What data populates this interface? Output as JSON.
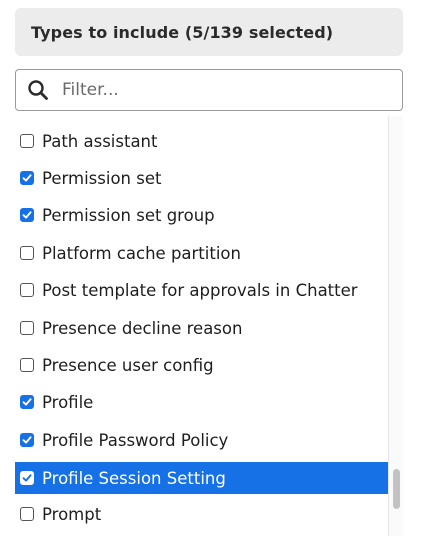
{
  "header": {
    "title": "Types to include (5/139 selected)"
  },
  "filter": {
    "placeholder": "Filter...",
    "value": ""
  },
  "list": {
    "items": [
      {
        "label": "Path assistant",
        "checked": false,
        "selected": false
      },
      {
        "label": "Permission set",
        "checked": true,
        "selected": false
      },
      {
        "label": "Permission set group",
        "checked": true,
        "selected": false
      },
      {
        "label": "Platform cache partition",
        "checked": false,
        "selected": false
      },
      {
        "label": "Post template for approvals in Chatter",
        "checked": false,
        "selected": false
      },
      {
        "label": "Presence decline reason",
        "checked": false,
        "selected": false
      },
      {
        "label": "Presence user config",
        "checked": false,
        "selected": false
      },
      {
        "label": "Profile",
        "checked": true,
        "selected": false
      },
      {
        "label": "Profile Password Policy",
        "checked": true,
        "selected": false
      },
      {
        "label": "Profile Session Setting",
        "checked": true,
        "selected": true
      },
      {
        "label": "Prompt",
        "checked": false,
        "selected": false
      }
    ]
  },
  "colors": {
    "accent": "#1670e6",
    "header_bg": "#ececec"
  },
  "icons": {
    "search": "search-icon",
    "check": "check-icon"
  }
}
